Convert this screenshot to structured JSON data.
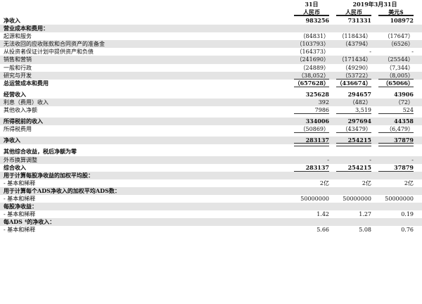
{
  "header": {
    "col1_top": "31日",
    "col23_top": "2019年3月31日",
    "col1": "人民币",
    "col2": "人民币",
    "col3": "美元$"
  },
  "rows": [
    {
      "label": "净收入",
      "v": [
        "983256",
        "731331",
        "108972"
      ],
      "bold": true,
      "shade": false
    },
    {
      "label": "营业成本和费用：",
      "v": [
        "",
        "",
        ""
      ],
      "bold": true,
      "shade": true
    },
    {
      "label": "起源和服务",
      "v": [
        "（84831）",
        "（118434）",
        "（17647）"
      ],
      "bold": false,
      "shade": false
    },
    {
      "label": "无法收回的应收账款和合同资产的准备金",
      "v": [
        "（103793）",
        "（43794）",
        "（6526）"
      ],
      "bold": false,
      "shade": true
    },
    {
      "label": "从投资者保证计划中提供资产和负债",
      "v": [
        "（164373）",
        "-",
        "-"
      ],
      "bold": false,
      "shade": false
    },
    {
      "label": "销售和营销",
      "v": [
        "（241690）",
        "（171434）",
        "（25544）"
      ],
      "bold": false,
      "shade": true
    },
    {
      "label": "一般和行政",
      "v": [
        "（24889）",
        "（49290）",
        "（7,344）"
      ],
      "bold": false,
      "shade": false
    },
    {
      "label": "研究与开发",
      "v": [
        "（38,052）",
        "（53722）",
        "（8,005）"
      ],
      "bold": false,
      "shade": true
    },
    {
      "label": "总运营成本和费用",
      "v": [
        "（657628）",
        "（436674）",
        "（65066）"
      ],
      "bold": true,
      "shade": false
    },
    {
      "gap": true
    },
    {
      "label": "经营收入",
      "v": [
        "325628",
        "294657",
        "43906"
      ],
      "bold": true,
      "shade": false
    },
    {
      "label": "利息（费用）收入",
      "v": [
        "392",
        "（482）",
        "（72）"
      ],
      "bold": false,
      "shade": true
    },
    {
      "label": "其他收入净额",
      "v": [
        "7986",
        "3,519",
        "524"
      ],
      "bold": false,
      "shade": false
    },
    {
      "gap": true
    },
    {
      "label": "所得税前的收入",
      "v": [
        "334006",
        "297694",
        "44358"
      ],
      "bold": true,
      "shade": true
    },
    {
      "label": "所得税费用",
      "v": [
        "（50869）",
        "（43479）",
        "（6,479）"
      ],
      "bold": false,
      "shade": false
    },
    {
      "gap": true
    },
    {
      "label": "净收入",
      "v": [
        "283137",
        "254215",
        "37879"
      ],
      "bold": true,
      "shade": true
    },
    {
      "gap": true
    },
    {
      "label": "其他综合收益，税后净额为零",
      "v": [
        "",
        "",
        ""
      ],
      "bold": true,
      "shade": false
    },
    {
      "label": "外币换算调整",
      "v": [
        "-",
        "-",
        "-"
      ],
      "bold": false,
      "shade": true
    },
    {
      "label": "综合收入",
      "v": [
        "283137",
        "254215",
        "37879"
      ],
      "bold": true,
      "shade": false
    },
    {
      "label": "用于计算每股净收益的加权平均股：",
      "v": [
        "",
        "",
        ""
      ],
      "bold": true,
      "shade": true
    },
    {
      "label": "- 基本和稀释",
      "v": [
        "2亿",
        "2亿",
        "2亿"
      ],
      "bold": false,
      "shade": false
    },
    {
      "label": "用于计算每个ADS净收入的加权平均ADS数：",
      "v": [
        "",
        "",
        ""
      ],
      "bold": true,
      "shade": true
    },
    {
      "label": "- 基本和稀释",
      "v": [
        "50000000",
        "50000000",
        "50000000"
      ],
      "bold": false,
      "shade": false
    },
    {
      "label": "每股净收益：",
      "v": [
        "",
        "",
        ""
      ],
      "bold": true,
      "shade": true
    },
    {
      "label": "- 基本和稀释",
      "v": [
        "1.42",
        "1.27",
        "0.19"
      ],
      "bold": false,
      "shade": false
    },
    {
      "label": "每ADS ⁴的净收入：",
      "v": [
        "",
        "",
        ""
      ],
      "bold": true,
      "shade": true
    },
    {
      "label": "- 基本和稀释",
      "v": [
        "5.66",
        "5.08",
        "0.76"
      ],
      "bold": false,
      "shade": false
    }
  ]
}
